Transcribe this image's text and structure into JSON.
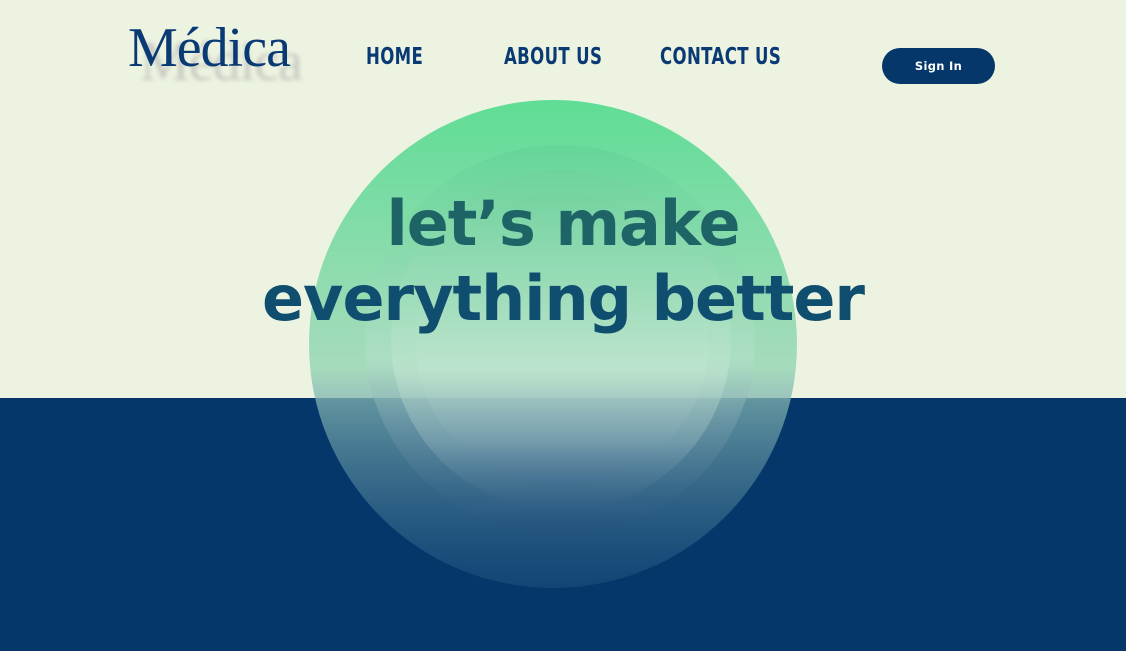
{
  "brand": {
    "logo_text": "Médica"
  },
  "nav": {
    "items": [
      {
        "label": "HOME"
      },
      {
        "label": "ABOUT US"
      },
      {
        "label": "CONTACT US"
      }
    ],
    "signin_label": "Sign In"
  },
  "hero": {
    "line1": "let’s make",
    "line2": "everything better"
  },
  "colors": {
    "background_light": "#ecf4e1",
    "navy": "#05376a",
    "green_accent": "#5fdd95",
    "text_teal": "#1e6466"
  }
}
